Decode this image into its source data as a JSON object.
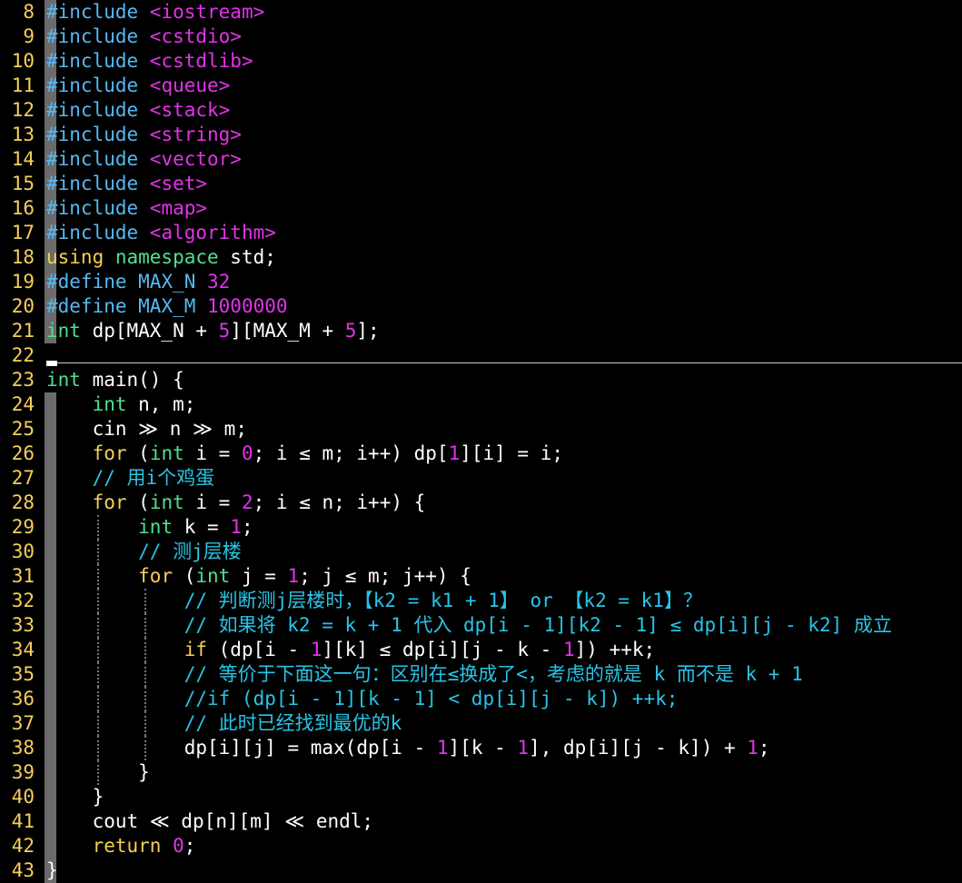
{
  "editor": {
    "lines": [
      {
        "n": "8",
        "segs": [
          {
            "c": "kw-pre",
            "t": "#include "
          },
          {
            "c": "str",
            "t": "<iostream>"
          }
        ]
      },
      {
        "n": "9",
        "segs": [
          {
            "c": "kw-pre",
            "t": "#include "
          },
          {
            "c": "str",
            "t": "<cstdio>"
          }
        ]
      },
      {
        "n": "10",
        "segs": [
          {
            "c": "kw-pre",
            "t": "#include "
          },
          {
            "c": "str",
            "t": "<cstdlib>"
          }
        ]
      },
      {
        "n": "11",
        "segs": [
          {
            "c": "kw-pre",
            "t": "#include "
          },
          {
            "c": "str",
            "t": "<queue>"
          }
        ]
      },
      {
        "n": "12",
        "segs": [
          {
            "c": "kw-pre",
            "t": "#include "
          },
          {
            "c": "str",
            "t": "<stack>"
          }
        ]
      },
      {
        "n": "13",
        "segs": [
          {
            "c": "kw-pre",
            "t": "#include "
          },
          {
            "c": "str",
            "t": "<string>"
          }
        ]
      },
      {
        "n": "14",
        "segs": [
          {
            "c": "kw-pre",
            "t": "#include "
          },
          {
            "c": "str",
            "t": "<vector>"
          }
        ]
      },
      {
        "n": "15",
        "segs": [
          {
            "c": "kw-pre",
            "t": "#include "
          },
          {
            "c": "str",
            "t": "<set>"
          }
        ]
      },
      {
        "n": "16",
        "segs": [
          {
            "c": "kw-pre",
            "t": "#include "
          },
          {
            "c": "str",
            "t": "<map>"
          }
        ]
      },
      {
        "n": "17",
        "segs": [
          {
            "c": "kw-pre",
            "t": "#include "
          },
          {
            "c": "str",
            "t": "<algorithm>"
          }
        ]
      },
      {
        "n": "18",
        "segs": [
          {
            "c": "kw-ctl",
            "t": "using "
          },
          {
            "c": "kw-ns",
            "t": "namespace "
          },
          {
            "c": "",
            "t": "std;"
          }
        ]
      },
      {
        "n": "19",
        "segs": [
          {
            "c": "kw-pre",
            "t": "#define "
          },
          {
            "c": "macro",
            "t": "MAX_N "
          },
          {
            "c": "num",
            "t": "32"
          }
        ]
      },
      {
        "n": "20",
        "segs": [
          {
            "c": "kw-pre",
            "t": "#define "
          },
          {
            "c": "macro",
            "t": "MAX_M "
          },
          {
            "c": "num",
            "t": "1000000"
          }
        ]
      },
      {
        "n": "21",
        "segs": [
          {
            "c": "kw-type",
            "t": "int "
          },
          {
            "c": "",
            "t": "dp[MAX_N + "
          },
          {
            "c": "num",
            "t": "5"
          },
          {
            "c": "",
            "t": "][MAX_M + "
          },
          {
            "c": "num",
            "t": "5"
          },
          {
            "c": "",
            "t": "];"
          }
        ]
      },
      {
        "n": "22",
        "segs": []
      },
      {
        "n": "23",
        "segs": [
          {
            "c": "kw-type",
            "t": "int "
          },
          {
            "c": "",
            "t": "main() {"
          }
        ]
      },
      {
        "n": "24",
        "segs": [
          {
            "c": "",
            "t": "    "
          },
          {
            "c": "kw-type",
            "t": "int "
          },
          {
            "c": "",
            "t": "n, m;"
          }
        ]
      },
      {
        "n": "25",
        "segs": [
          {
            "c": "",
            "t": "    cin ≫ n ≫ m;"
          }
        ]
      },
      {
        "n": "26",
        "segs": [
          {
            "c": "",
            "t": "    "
          },
          {
            "c": "kw-ctl",
            "t": "for "
          },
          {
            "c": "",
            "t": "("
          },
          {
            "c": "kw-type",
            "t": "int "
          },
          {
            "c": "",
            "t": "i = "
          },
          {
            "c": "num",
            "t": "0"
          },
          {
            "c": "",
            "t": "; i ≤ m; i++) dp["
          },
          {
            "c": "num",
            "t": "1"
          },
          {
            "c": "",
            "t": "][i] = i;"
          }
        ]
      },
      {
        "n": "27",
        "segs": [
          {
            "c": "",
            "t": "    "
          },
          {
            "c": "cmt",
            "t": "// 用i个鸡蛋"
          }
        ]
      },
      {
        "n": "28",
        "segs": [
          {
            "c": "",
            "t": "    "
          },
          {
            "c": "kw-ctl",
            "t": "for "
          },
          {
            "c": "",
            "t": "("
          },
          {
            "c": "kw-type",
            "t": "int "
          },
          {
            "c": "",
            "t": "i = "
          },
          {
            "c": "num",
            "t": "2"
          },
          {
            "c": "",
            "t": "; i ≤ n; i++) {"
          }
        ]
      },
      {
        "n": "29",
        "segs": [
          {
            "c": "",
            "t": "        "
          },
          {
            "c": "kw-type",
            "t": "int "
          },
          {
            "c": "",
            "t": "k = "
          },
          {
            "c": "num",
            "t": "1"
          },
          {
            "c": "",
            "t": ";"
          }
        ]
      },
      {
        "n": "30",
        "segs": [
          {
            "c": "",
            "t": "        "
          },
          {
            "c": "cmt",
            "t": "// 测j层楼"
          }
        ]
      },
      {
        "n": "31",
        "segs": [
          {
            "c": "",
            "t": "        "
          },
          {
            "c": "kw-ctl",
            "t": "for "
          },
          {
            "c": "",
            "t": "("
          },
          {
            "c": "kw-type",
            "t": "int "
          },
          {
            "c": "",
            "t": "j = "
          },
          {
            "c": "num",
            "t": "1"
          },
          {
            "c": "",
            "t": "; j ≤ m; j++) {"
          }
        ]
      },
      {
        "n": "32",
        "segs": [
          {
            "c": "",
            "t": "            "
          },
          {
            "c": "cmt",
            "t": "// 判断测j层楼时，【k2 = k1 + 1】 or 【k2 = k1】？"
          }
        ]
      },
      {
        "n": "33",
        "segs": [
          {
            "c": "",
            "t": "            "
          },
          {
            "c": "cmt",
            "t": "// 如果将 k2 = k + 1 代入 dp[i - 1][k2 - 1] ≤ dp[i][j - k2] 成立"
          }
        ]
      },
      {
        "n": "34",
        "segs": [
          {
            "c": "",
            "t": "            "
          },
          {
            "c": "kw-ctl",
            "t": "if "
          },
          {
            "c": "",
            "t": "(dp[i - "
          },
          {
            "c": "num",
            "t": "1"
          },
          {
            "c": "",
            "t": "][k] ≤ dp[i][j - k - "
          },
          {
            "c": "num",
            "t": "1"
          },
          {
            "c": "",
            "t": "]) ++k;"
          }
        ]
      },
      {
        "n": "35",
        "segs": [
          {
            "c": "",
            "t": "            "
          },
          {
            "c": "cmt",
            "t": "// 等价于下面这一句：区别在≤换成了<，考虑的就是 k 而不是 k + 1"
          }
        ]
      },
      {
        "n": "36",
        "segs": [
          {
            "c": "",
            "t": "            "
          },
          {
            "c": "cmt",
            "t": "//if (dp[i - 1][k - 1] < dp[i][j - k]) ++k;"
          }
        ]
      },
      {
        "n": "37",
        "segs": [
          {
            "c": "",
            "t": "            "
          },
          {
            "c": "cmt",
            "t": "// 此时已经找到最优的k"
          }
        ]
      },
      {
        "n": "38",
        "segs": [
          {
            "c": "",
            "t": "            dp[i][j] = max(dp[i - "
          },
          {
            "c": "num",
            "t": "1"
          },
          {
            "c": "",
            "t": "][k - "
          },
          {
            "c": "num",
            "t": "1"
          },
          {
            "c": "",
            "t": "], dp[i][j - k]) + "
          },
          {
            "c": "num",
            "t": "1"
          },
          {
            "c": "",
            "t": ";"
          }
        ]
      },
      {
        "n": "39",
        "segs": [
          {
            "c": "",
            "t": "        }"
          }
        ]
      },
      {
        "n": "40",
        "segs": [
          {
            "c": "",
            "t": "    }"
          }
        ]
      },
      {
        "n": "41",
        "segs": [
          {
            "c": "",
            "t": "    cout ≪ dp[n][m] ≪ endl;"
          }
        ]
      },
      {
        "n": "42",
        "segs": [
          {
            "c": "",
            "t": "    "
          },
          {
            "c": "kw-ctl",
            "t": "return "
          },
          {
            "c": "num",
            "t": "0"
          },
          {
            "c": "",
            "t": ";"
          }
        ]
      },
      {
        "n": "43",
        "segs": [
          {
            "c": "",
            "t": "}"
          }
        ]
      }
    ]
  }
}
